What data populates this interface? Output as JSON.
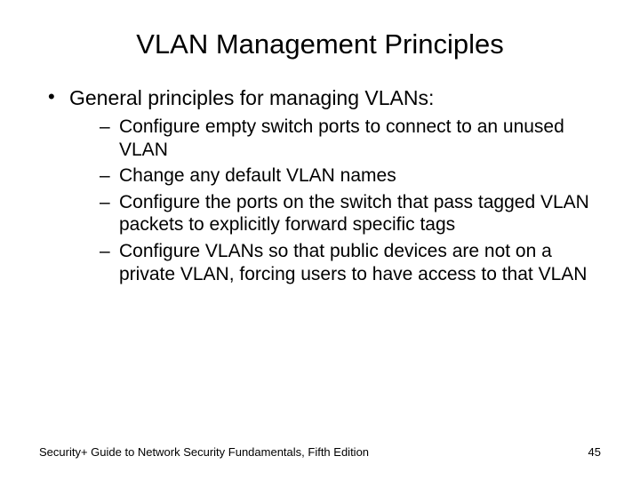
{
  "title": "VLAN Management Principles",
  "top_bullet": "General principles for managing VLANs:",
  "subs": {
    "a": "Configure empty switch ports to connect to an unused VLAN",
    "b": "Change any default VLAN names",
    "c": "Configure the ports on the switch that pass tagged VLAN packets to explicitly forward specific tags",
    "d": "Configure VLANs so that public devices are not on a private VLAN, forcing users to have access to that VLAN"
  },
  "footer_left": "Security+ Guide to Network Security Fundamentals, Fifth Edition",
  "footer_right": "45"
}
